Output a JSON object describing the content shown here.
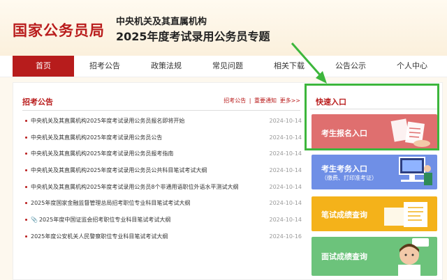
{
  "header": {
    "logo": "国家公务员局",
    "subtitle_line1": "中央机关及其直属机构",
    "subtitle_line2": "2025年度考试录用公务员专题"
  },
  "nav": {
    "items": [
      {
        "label": "首页",
        "active": true
      },
      {
        "label": "招考公告"
      },
      {
        "label": "政策法规"
      },
      {
        "label": "常见问题"
      },
      {
        "label": "相关下载"
      },
      {
        "label": "公告公示"
      },
      {
        "label": "个人中心"
      }
    ]
  },
  "announcements": {
    "title": "招考公告",
    "tabs": [
      "招考公告",
      "|",
      "重要通知",
      "更多>>"
    ],
    "items": [
      {
        "text": "中央机关及其直属机构2025年度考试录用公务员报名即将开始",
        "date": "2024-10-14"
      },
      {
        "text": "中央机关及其直属机构2025年度考试录用公务员公告",
        "date": "2024-10-14"
      },
      {
        "text": "中央机关及其直属机构2025年度考试录用公务员报考指南",
        "date": "2024-10-14"
      },
      {
        "text": "中央机关及其直属机构2025年度考试录用公务员公共科目笔试考试大纲",
        "date": "2024-10-14"
      },
      {
        "text": "中央机关及其直属机构2025年度考试录用公务员8个非通用语职位外语水平测试大纲",
        "date": "2024-10-14"
      },
      {
        "text": "2025年度国家金融监督管理总局招考职位专业科目笔试考试大纲",
        "date": "2024-10-14"
      },
      {
        "text": "2025年度中国证监会招考职位专业科目笔试考试大纲",
        "date": "2024-10-14",
        "attachment": true
      },
      {
        "text": "2025年度公安机关人民警察职位专业科目笔试考试大纲",
        "date": "2024-10-16"
      }
    ]
  },
  "quick": {
    "title": "快速入口",
    "cards": [
      {
        "label": "考生报名入口",
        "color": "#df6f6f"
      },
      {
        "label": "考生考务入口",
        "sub": "（缴费、打印准考证）",
        "color": "#6f8fe6"
      },
      {
        "label": "笔试成绩查询",
        "color": "#f4b21a"
      },
      {
        "label": "面试成绩查询",
        "color": "#6cc37b"
      }
    ]
  },
  "highlight_color": "#3db63c"
}
